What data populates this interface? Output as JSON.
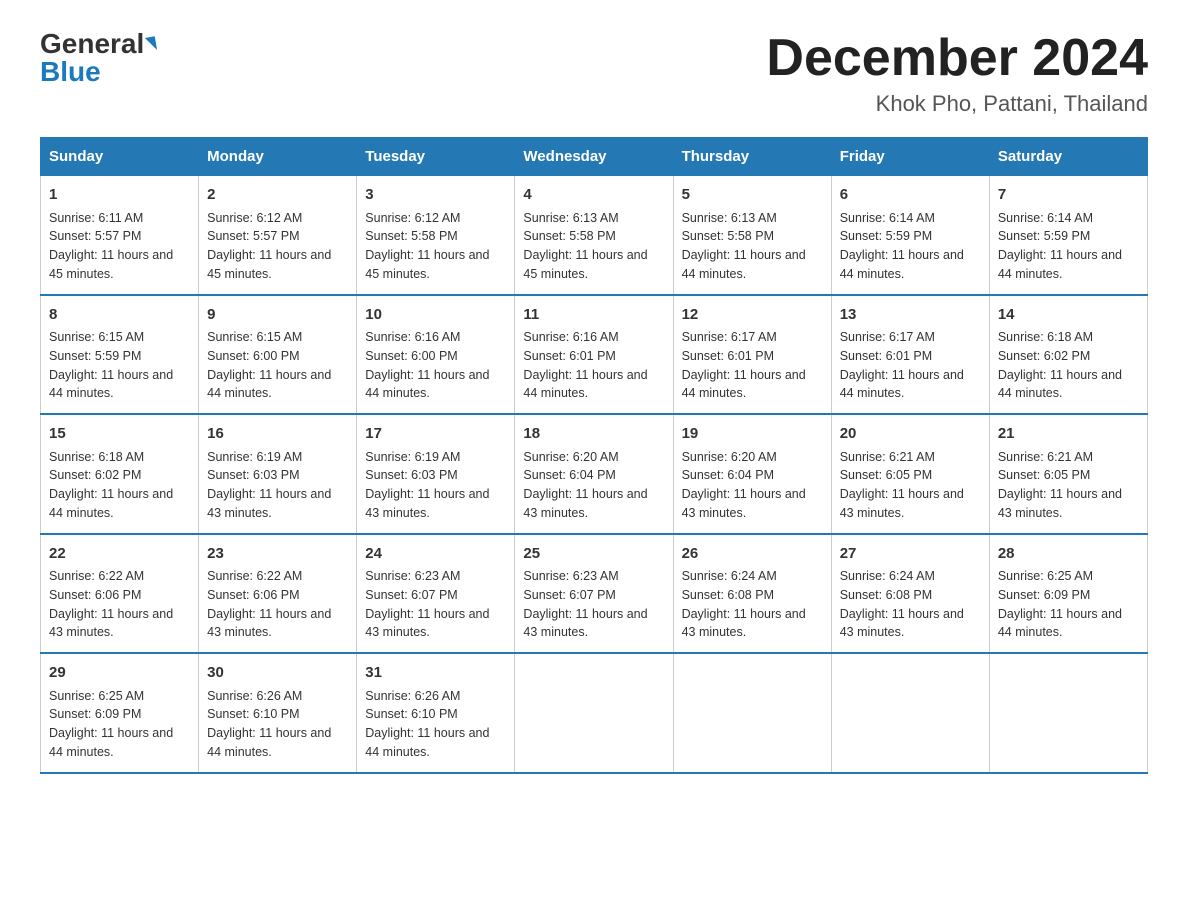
{
  "logo": {
    "general": "General",
    "blue": "Blue"
  },
  "title": "December 2024",
  "location": "Khok Pho, Pattani, Thailand",
  "headers": [
    "Sunday",
    "Monday",
    "Tuesday",
    "Wednesday",
    "Thursday",
    "Friday",
    "Saturday"
  ],
  "weeks": [
    [
      {
        "day": "1",
        "sunrise": "6:11 AM",
        "sunset": "5:57 PM",
        "daylight": "11 hours and 45 minutes."
      },
      {
        "day": "2",
        "sunrise": "6:12 AM",
        "sunset": "5:57 PM",
        "daylight": "11 hours and 45 minutes."
      },
      {
        "day": "3",
        "sunrise": "6:12 AM",
        "sunset": "5:58 PM",
        "daylight": "11 hours and 45 minutes."
      },
      {
        "day": "4",
        "sunrise": "6:13 AM",
        "sunset": "5:58 PM",
        "daylight": "11 hours and 45 minutes."
      },
      {
        "day": "5",
        "sunrise": "6:13 AM",
        "sunset": "5:58 PM",
        "daylight": "11 hours and 44 minutes."
      },
      {
        "day": "6",
        "sunrise": "6:14 AM",
        "sunset": "5:59 PM",
        "daylight": "11 hours and 44 minutes."
      },
      {
        "day": "7",
        "sunrise": "6:14 AM",
        "sunset": "5:59 PM",
        "daylight": "11 hours and 44 minutes."
      }
    ],
    [
      {
        "day": "8",
        "sunrise": "6:15 AM",
        "sunset": "5:59 PM",
        "daylight": "11 hours and 44 minutes."
      },
      {
        "day": "9",
        "sunrise": "6:15 AM",
        "sunset": "6:00 PM",
        "daylight": "11 hours and 44 minutes."
      },
      {
        "day": "10",
        "sunrise": "6:16 AM",
        "sunset": "6:00 PM",
        "daylight": "11 hours and 44 minutes."
      },
      {
        "day": "11",
        "sunrise": "6:16 AM",
        "sunset": "6:01 PM",
        "daylight": "11 hours and 44 minutes."
      },
      {
        "day": "12",
        "sunrise": "6:17 AM",
        "sunset": "6:01 PM",
        "daylight": "11 hours and 44 minutes."
      },
      {
        "day": "13",
        "sunrise": "6:17 AM",
        "sunset": "6:01 PM",
        "daylight": "11 hours and 44 minutes."
      },
      {
        "day": "14",
        "sunrise": "6:18 AM",
        "sunset": "6:02 PM",
        "daylight": "11 hours and 44 minutes."
      }
    ],
    [
      {
        "day": "15",
        "sunrise": "6:18 AM",
        "sunset": "6:02 PM",
        "daylight": "11 hours and 44 minutes."
      },
      {
        "day": "16",
        "sunrise": "6:19 AM",
        "sunset": "6:03 PM",
        "daylight": "11 hours and 43 minutes."
      },
      {
        "day": "17",
        "sunrise": "6:19 AM",
        "sunset": "6:03 PM",
        "daylight": "11 hours and 43 minutes."
      },
      {
        "day": "18",
        "sunrise": "6:20 AM",
        "sunset": "6:04 PM",
        "daylight": "11 hours and 43 minutes."
      },
      {
        "day": "19",
        "sunrise": "6:20 AM",
        "sunset": "6:04 PM",
        "daylight": "11 hours and 43 minutes."
      },
      {
        "day": "20",
        "sunrise": "6:21 AM",
        "sunset": "6:05 PM",
        "daylight": "11 hours and 43 minutes."
      },
      {
        "day": "21",
        "sunrise": "6:21 AM",
        "sunset": "6:05 PM",
        "daylight": "11 hours and 43 minutes."
      }
    ],
    [
      {
        "day": "22",
        "sunrise": "6:22 AM",
        "sunset": "6:06 PM",
        "daylight": "11 hours and 43 minutes."
      },
      {
        "day": "23",
        "sunrise": "6:22 AM",
        "sunset": "6:06 PM",
        "daylight": "11 hours and 43 minutes."
      },
      {
        "day": "24",
        "sunrise": "6:23 AM",
        "sunset": "6:07 PM",
        "daylight": "11 hours and 43 minutes."
      },
      {
        "day": "25",
        "sunrise": "6:23 AM",
        "sunset": "6:07 PM",
        "daylight": "11 hours and 43 minutes."
      },
      {
        "day": "26",
        "sunrise": "6:24 AM",
        "sunset": "6:08 PM",
        "daylight": "11 hours and 43 minutes."
      },
      {
        "day": "27",
        "sunrise": "6:24 AM",
        "sunset": "6:08 PM",
        "daylight": "11 hours and 43 minutes."
      },
      {
        "day": "28",
        "sunrise": "6:25 AM",
        "sunset": "6:09 PM",
        "daylight": "11 hours and 44 minutes."
      }
    ],
    [
      {
        "day": "29",
        "sunrise": "6:25 AM",
        "sunset": "6:09 PM",
        "daylight": "11 hours and 44 minutes."
      },
      {
        "day": "30",
        "sunrise": "6:26 AM",
        "sunset": "6:10 PM",
        "daylight": "11 hours and 44 minutes."
      },
      {
        "day": "31",
        "sunrise": "6:26 AM",
        "sunset": "6:10 PM",
        "daylight": "11 hours and 44 minutes."
      },
      null,
      null,
      null,
      null
    ]
  ]
}
